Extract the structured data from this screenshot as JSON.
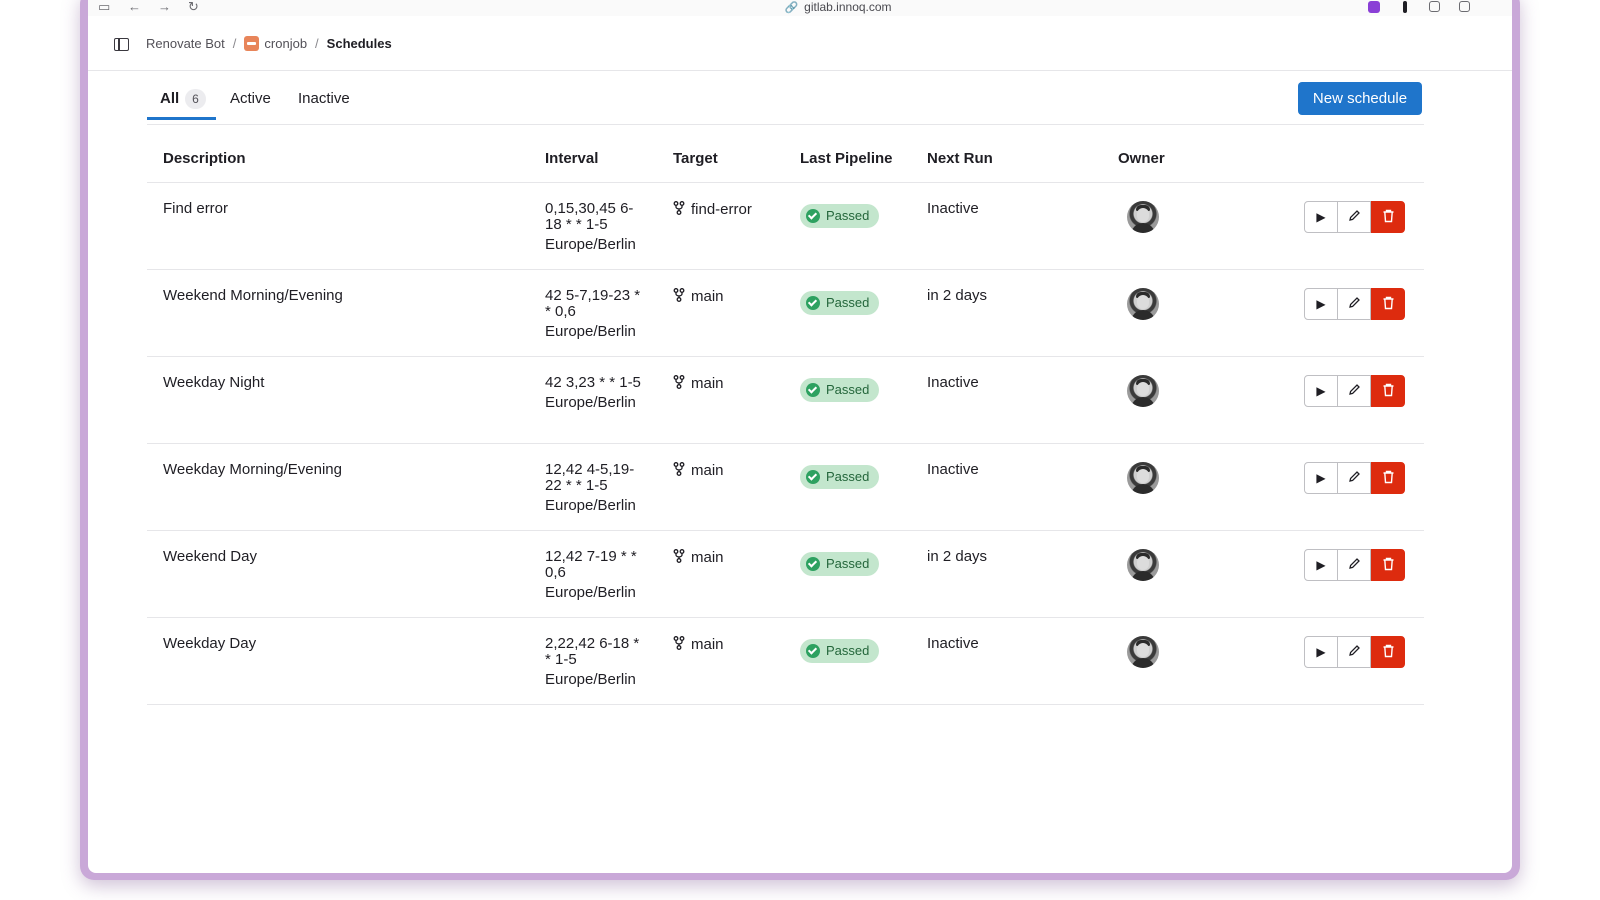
{
  "browser": {
    "url": "gitlab.innoq.com"
  },
  "breadcrumb": {
    "group": "Renovate Bot",
    "project": "cronjob",
    "current": "Schedules"
  },
  "tabs": [
    {
      "label": "All",
      "count": "6"
    },
    {
      "label": "Active"
    },
    {
      "label": "Inactive"
    }
  ],
  "new_schedule_label": "New schedule",
  "table": {
    "headers": [
      "Description",
      "Interval",
      "Target",
      "Last Pipeline",
      "Next Run",
      "Owner"
    ],
    "rows": [
      {
        "description": "Find error",
        "interval": "0,15,30,45 6-18 * * 1-5",
        "tz": "Europe/Berlin",
        "target": "find-error",
        "status": "Passed",
        "next_run": "Inactive"
      },
      {
        "description": "Weekend Morning/Evening",
        "interval": "42 5-7,19-23 * * 0,6",
        "tz": "Europe/Berlin",
        "target": "main",
        "status": "Passed",
        "next_run": "in 2 days"
      },
      {
        "description": "Weekday Night",
        "interval": "42 3,23 * * 1-5",
        "tz": "Europe/Berlin",
        "target": "main",
        "status": "Passed",
        "next_run": "Inactive"
      },
      {
        "description": "Weekday Morning/Evening",
        "interval": "12,42 4-5,19-22 * * 1-5",
        "tz": "Europe/Berlin",
        "target": "main",
        "status": "Passed",
        "next_run": "Inactive"
      },
      {
        "description": "Weekend Day",
        "interval": "12,42 7-19 * * 0,6",
        "tz": "Europe/Berlin",
        "target": "main",
        "status": "Passed",
        "next_run": "in 2 days"
      },
      {
        "description": "Weekday Day",
        "interval": "2,22,42 6-18 * * 1-5",
        "tz": "Europe/Berlin",
        "target": "main",
        "status": "Passed",
        "next_run": "Inactive"
      }
    ]
  },
  "colors": {
    "primary": "#1f75cb",
    "danger": "#dd2b0e",
    "success_bg": "#c3e6cd",
    "success_text": "#24663b",
    "frame": "#c9a8d8"
  },
  "icons": [
    "sidebar-icon",
    "back-arrow-icon",
    "forward-arrow-icon",
    "reload-icon",
    "link-icon",
    "branch-icon",
    "check-circle-icon",
    "play-icon",
    "pencil-icon",
    "trash-icon"
  ]
}
